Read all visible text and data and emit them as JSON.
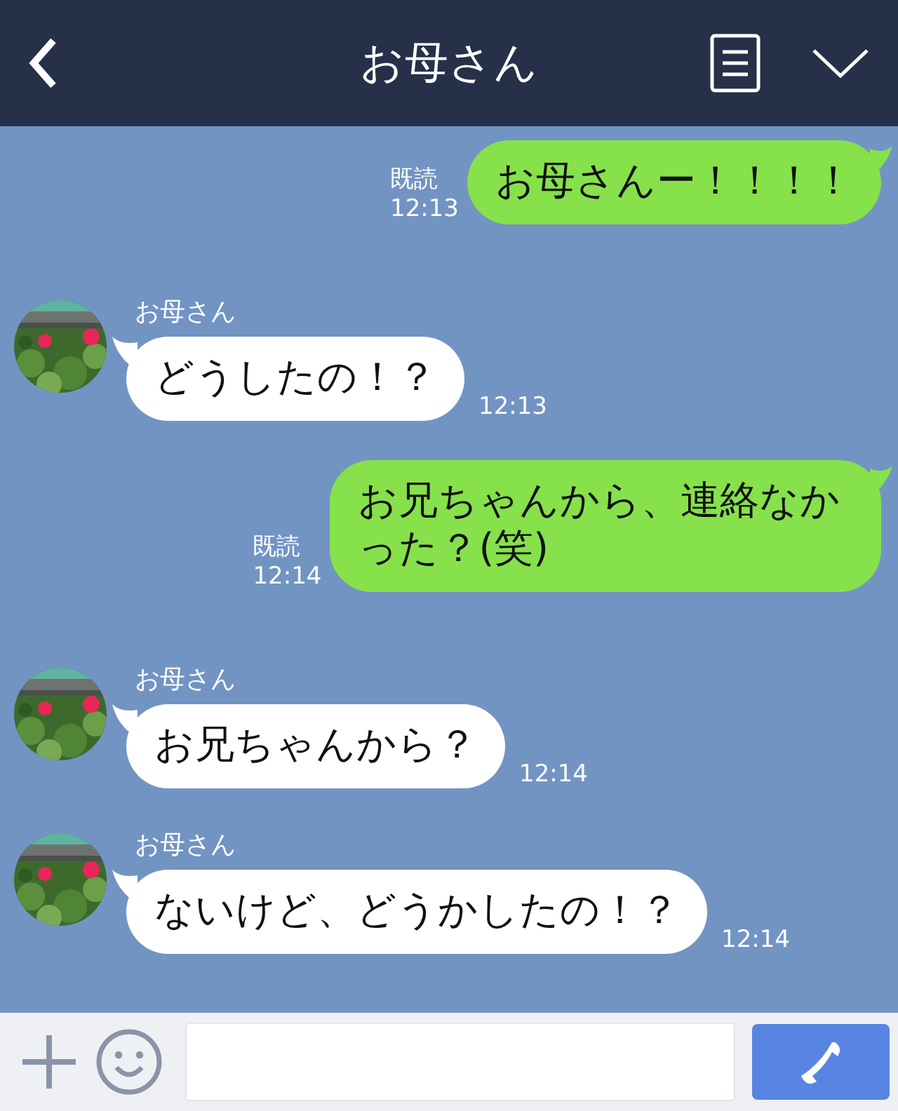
{
  "header": {
    "title": "お母さん"
  },
  "messages": [
    {
      "kind": "sent",
      "text": "お母さんー！！！！",
      "read": "既読",
      "time": "12:13"
    },
    {
      "kind": "received",
      "sender": "お母さん",
      "text": "どうしたの！？",
      "time": "12:13"
    },
    {
      "kind": "sent",
      "text": "お兄ちゃんから、連絡なかった？(笑)",
      "read": "既読",
      "time": "12:14"
    },
    {
      "kind": "received",
      "sender": "お母さん",
      "text": "お兄ちゃんから？",
      "time": "12:14"
    },
    {
      "kind": "received",
      "sender": "お母さん",
      "text": "ないけど、どうかしたの！？",
      "time": "12:14"
    }
  ]
}
